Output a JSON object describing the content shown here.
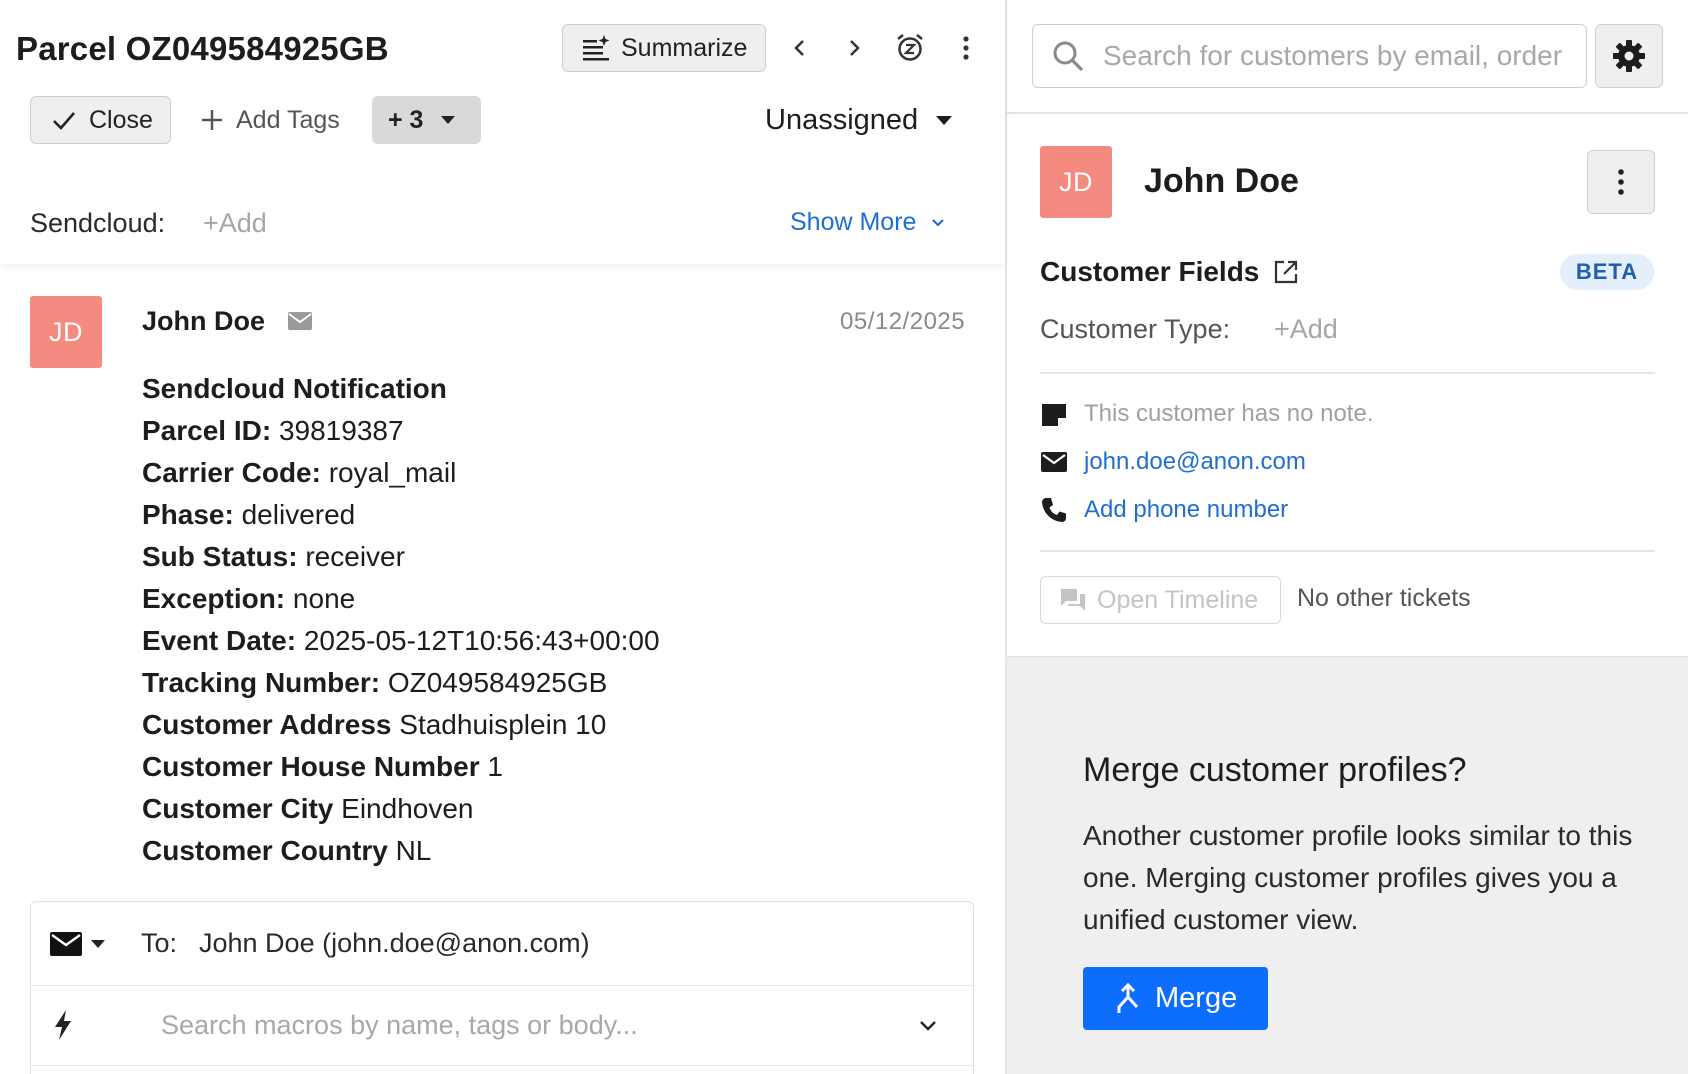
{
  "ticket": {
    "title": "Parcel OZ049584925GB",
    "summarize_label": "Summarize",
    "close_label": "Close",
    "add_tags_label": "Add Tags",
    "tags_more_label": "+ 3",
    "assignee": "Unassigned",
    "field_label": "Sendcloud:",
    "field_add": "+Add",
    "show_more_label": "Show More"
  },
  "message": {
    "avatar_initials": "JD",
    "sender": "John Doe",
    "date": "05/12/2025",
    "heading": "Sendcloud Notification",
    "lines": [
      {
        "key": "Parcel ID:",
        "value": "39819387"
      },
      {
        "key": "Carrier Code:",
        "value": "royal_mail"
      },
      {
        "key": "Phase:",
        "value": "delivered"
      },
      {
        "key": "Sub Status:",
        "value": "receiver"
      },
      {
        "key": "Exception:",
        "value": "none"
      },
      {
        "key": "Event Date:",
        "value": "2025-05-12T10:56:43+00:00"
      },
      {
        "key": "Tracking Number:",
        "value": "OZ049584925GB"
      },
      {
        "key": "Customer Address",
        "value": "Stadhuisplein 10"
      },
      {
        "key": "Customer House Number",
        "value": "1"
      },
      {
        "key": "Customer City",
        "value": "Eindhoven"
      },
      {
        "key": "Customer Country",
        "value": "NL"
      }
    ]
  },
  "reply": {
    "to_label": "To:",
    "to_value": "John Doe (john.doe@anon.com)",
    "macro_placeholder": "Search macros by name, tags or body..."
  },
  "customer": {
    "search_placeholder": "Search for customers by email, order",
    "avatar_initials": "JD",
    "name": "John Doe",
    "fields_title": "Customer Fields",
    "beta_label": "BETA",
    "type_label": "Customer Type:",
    "type_add": "+Add",
    "note": "This customer has no note.",
    "email": "john.doe@anon.com",
    "phone_label": "Add phone number",
    "timeline_label": "Open Timeline",
    "no_tickets": "No other tickets"
  },
  "merge": {
    "title": "Merge customer profiles?",
    "text": "Another customer profile looks similar to this one. Merging customer profiles gives you a unified customer view.",
    "button_label": "Merge"
  },
  "colors": {
    "avatar": "#f48a80",
    "link": "#1f6fd1",
    "primary_button": "#0d6efd",
    "beta_bg": "#e3effc"
  }
}
